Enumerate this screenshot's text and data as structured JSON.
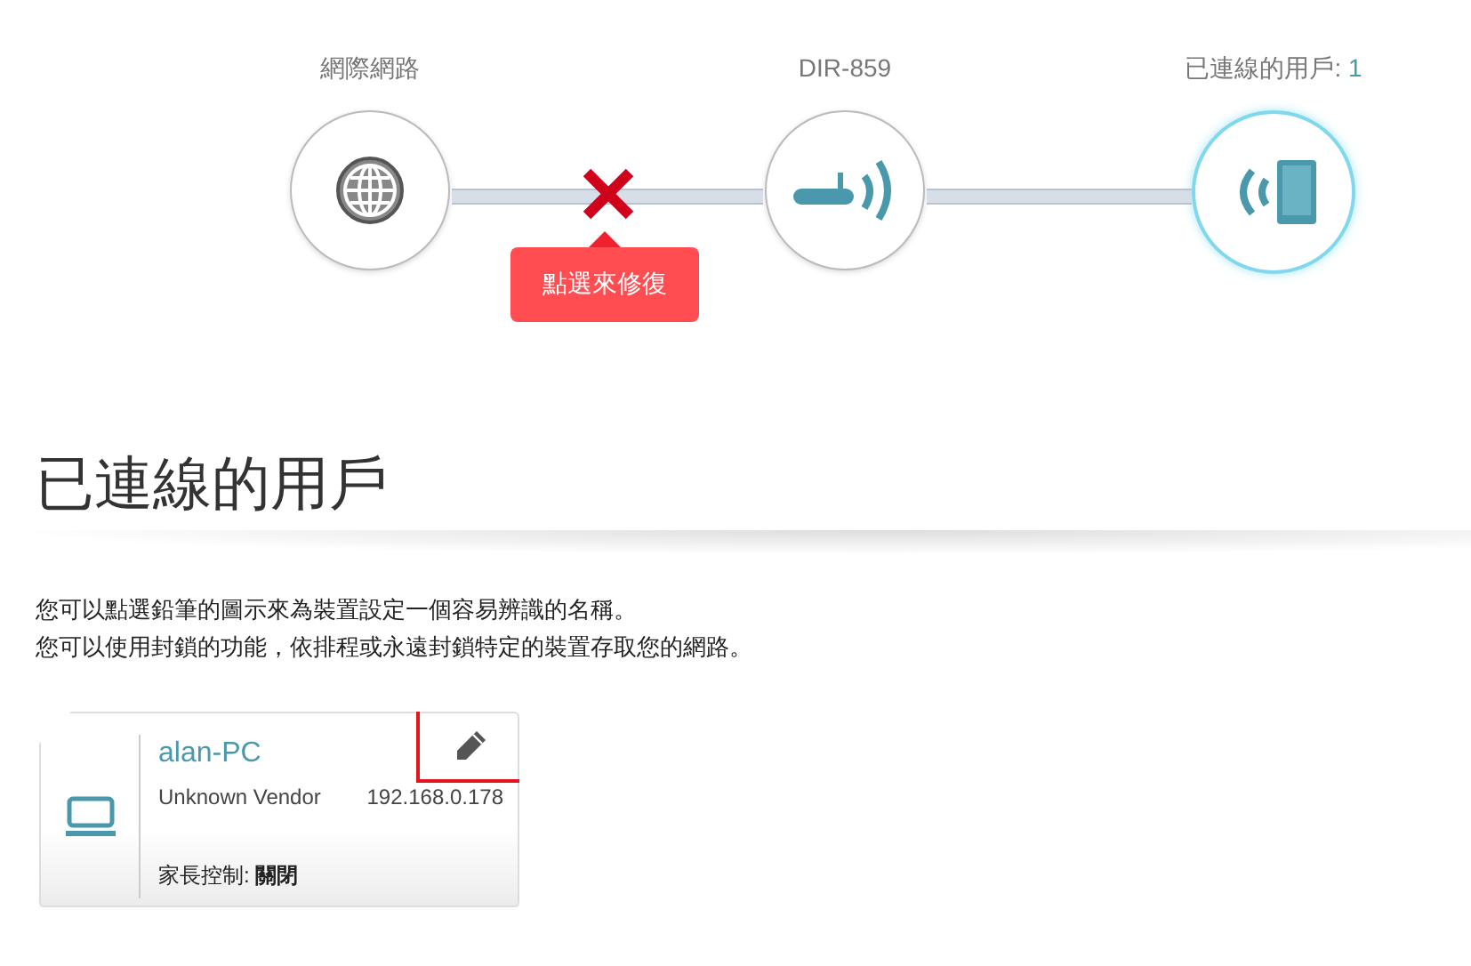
{
  "topology": {
    "nodes": [
      {
        "kind": "globe",
        "label": "網際網路",
        "selected": false
      },
      {
        "kind": "router",
        "label": "DIR-859",
        "selected": false
      },
      {
        "kind": "clients",
        "label": "已連線的用戶: ",
        "count": "1",
        "selected": true
      }
    ],
    "links": [
      {
        "broken": true,
        "fix_label": "點選來修復"
      },
      {
        "broken": false
      }
    ]
  },
  "section": {
    "title": "已連線的用戶",
    "description": [
      "您可以點選鉛筆的圖示來為裝置設定一個容易辨識的名稱。",
      "您可以使用封鎖的功能，依排程或永遠封鎖特定的裝置存取您的網路。"
    ]
  },
  "clients": [
    {
      "kind": "laptop",
      "name": "alan-PC",
      "vendor": "Unknown Vendor",
      "ip": "192.168.0.178",
      "parental_label": "家長控制: ",
      "parental_value": "關閉",
      "edit_highlighted": true
    }
  ]
}
